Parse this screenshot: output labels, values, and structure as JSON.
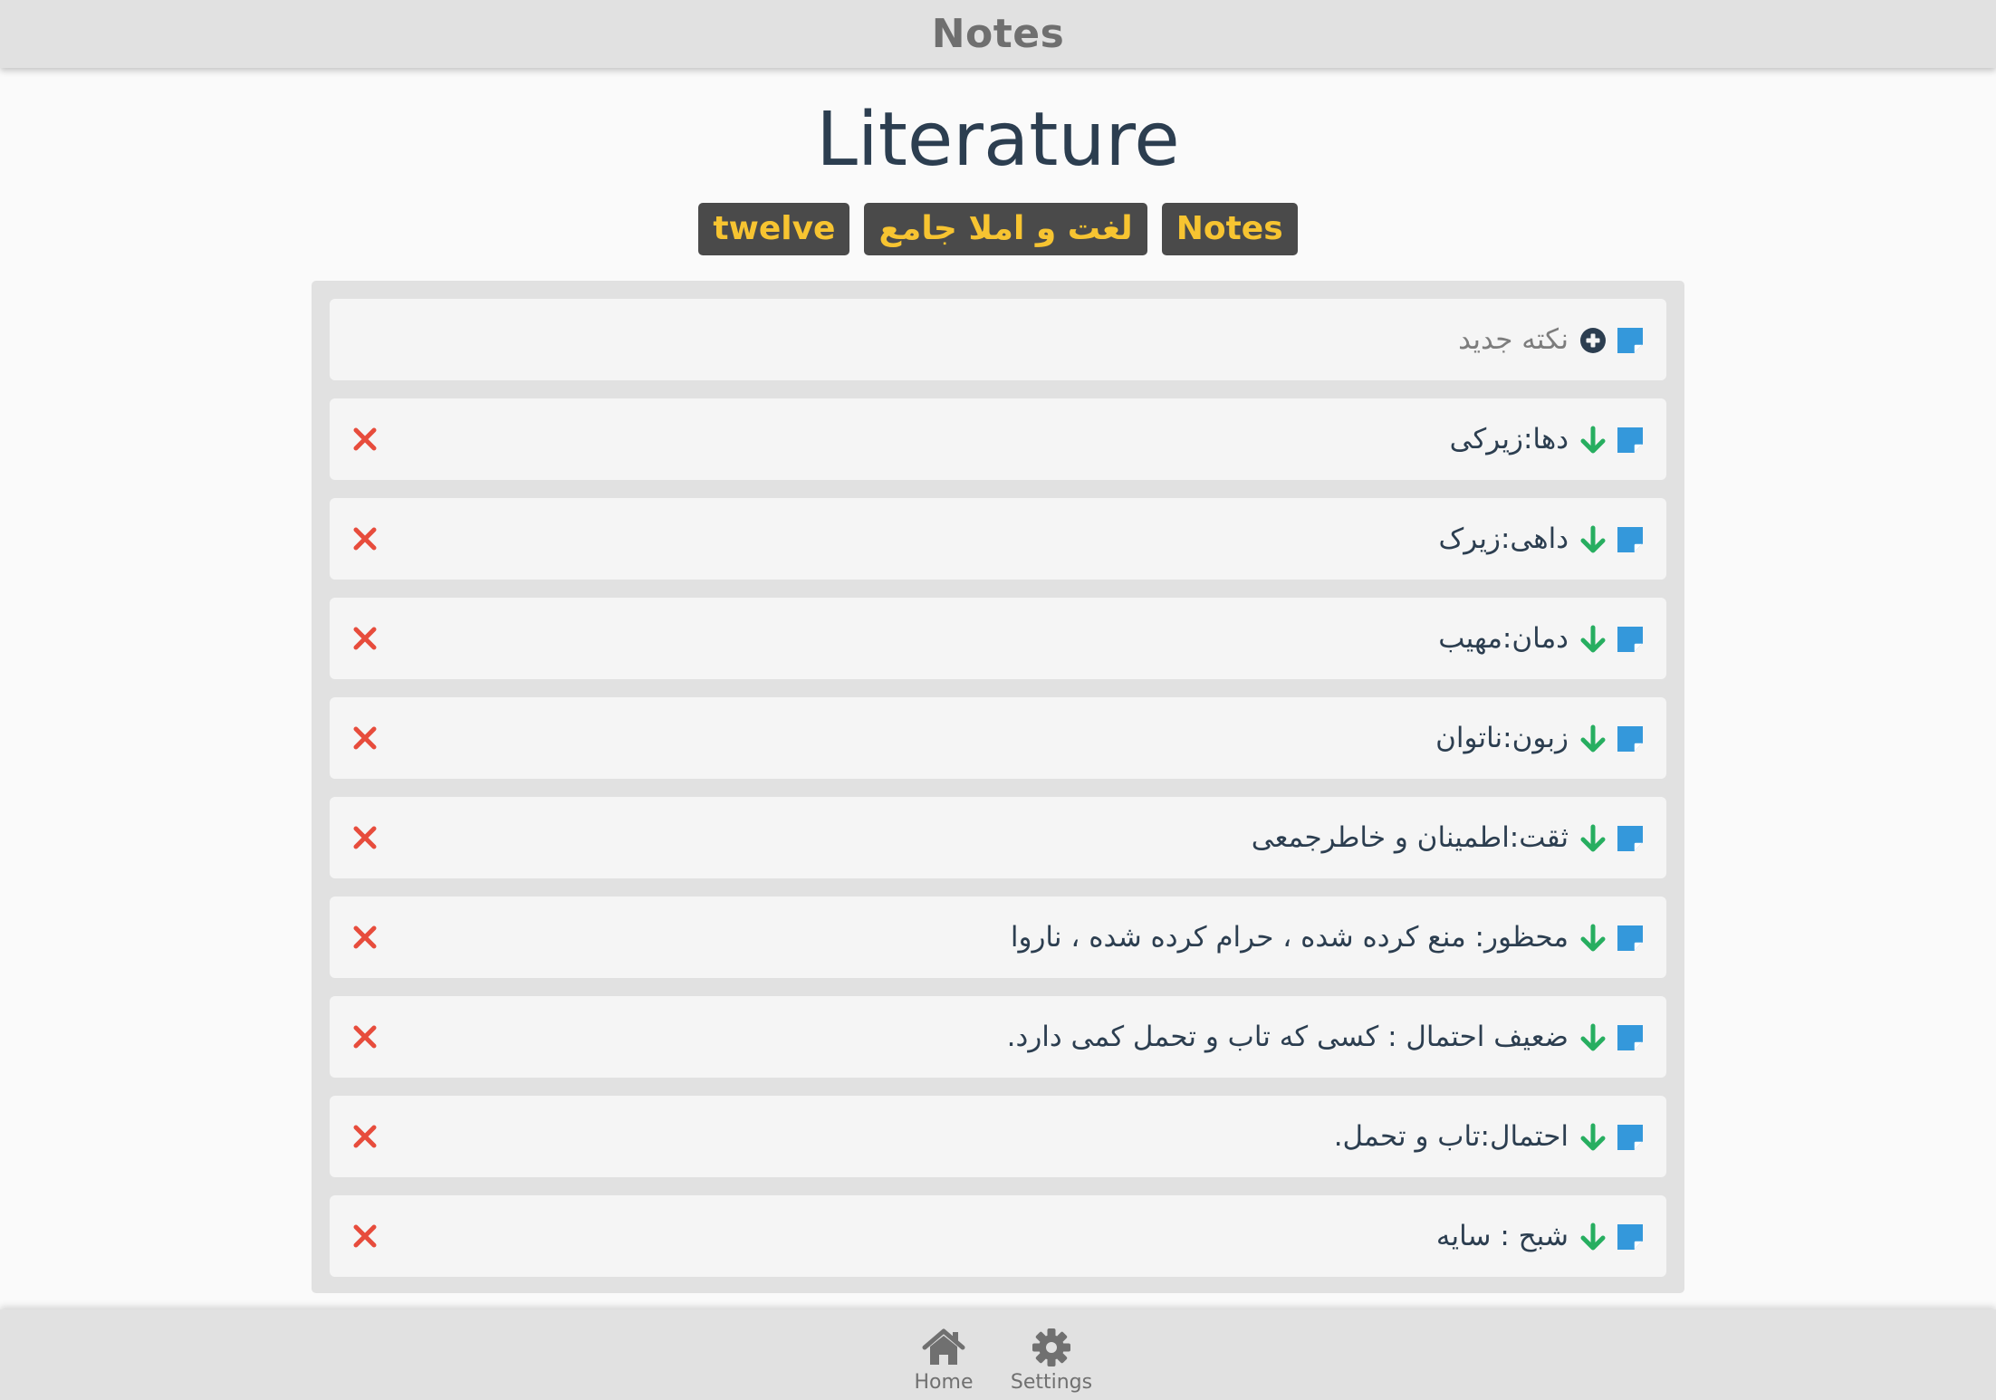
{
  "header": {
    "app_title": "Notes"
  },
  "page": {
    "title": "Literature",
    "tags": [
      "twelve",
      "لغت و املا جامع",
      "Notes"
    ]
  },
  "new_note": {
    "label": "نکته جدید",
    "icons": [
      "note-icon",
      "plus-circle-icon"
    ]
  },
  "notes": [
    {
      "text": "دها:زیرکی"
    },
    {
      "text": "داهی:زیرک"
    },
    {
      "text": "دمان:مهیب"
    },
    {
      "text": "زبون:ناتوان"
    },
    {
      "text": "ثقت:اطمینان و خاطرجمعی"
    },
    {
      "text": "محظور: منع کرده شده ، حرام کرده شده ، ناروا"
    },
    {
      "text": "ضعیف احتمال : کسی که تاب و تحمل کمی دارد."
    },
    {
      "text": "احتمال:تاب و تحمل."
    },
    {
      "text": "شبح : سایه"
    }
  ],
  "note_icons": [
    "note-icon",
    "arrow-down-icon",
    "close-icon"
  ],
  "bottom_nav": {
    "items": [
      {
        "label": "Home",
        "icon": "home-icon"
      },
      {
        "label": "Settings",
        "icon": "gear-icon"
      }
    ]
  },
  "colors": {
    "topbar": "#e1e1e1",
    "title": "#2c3e50",
    "tag_bg": "#4a4a4a",
    "tag_text": "#f7c431",
    "note_icon": "#3498db",
    "arrow": "#27ae60",
    "delete": "#e74c3c",
    "nav": "#707070"
  }
}
